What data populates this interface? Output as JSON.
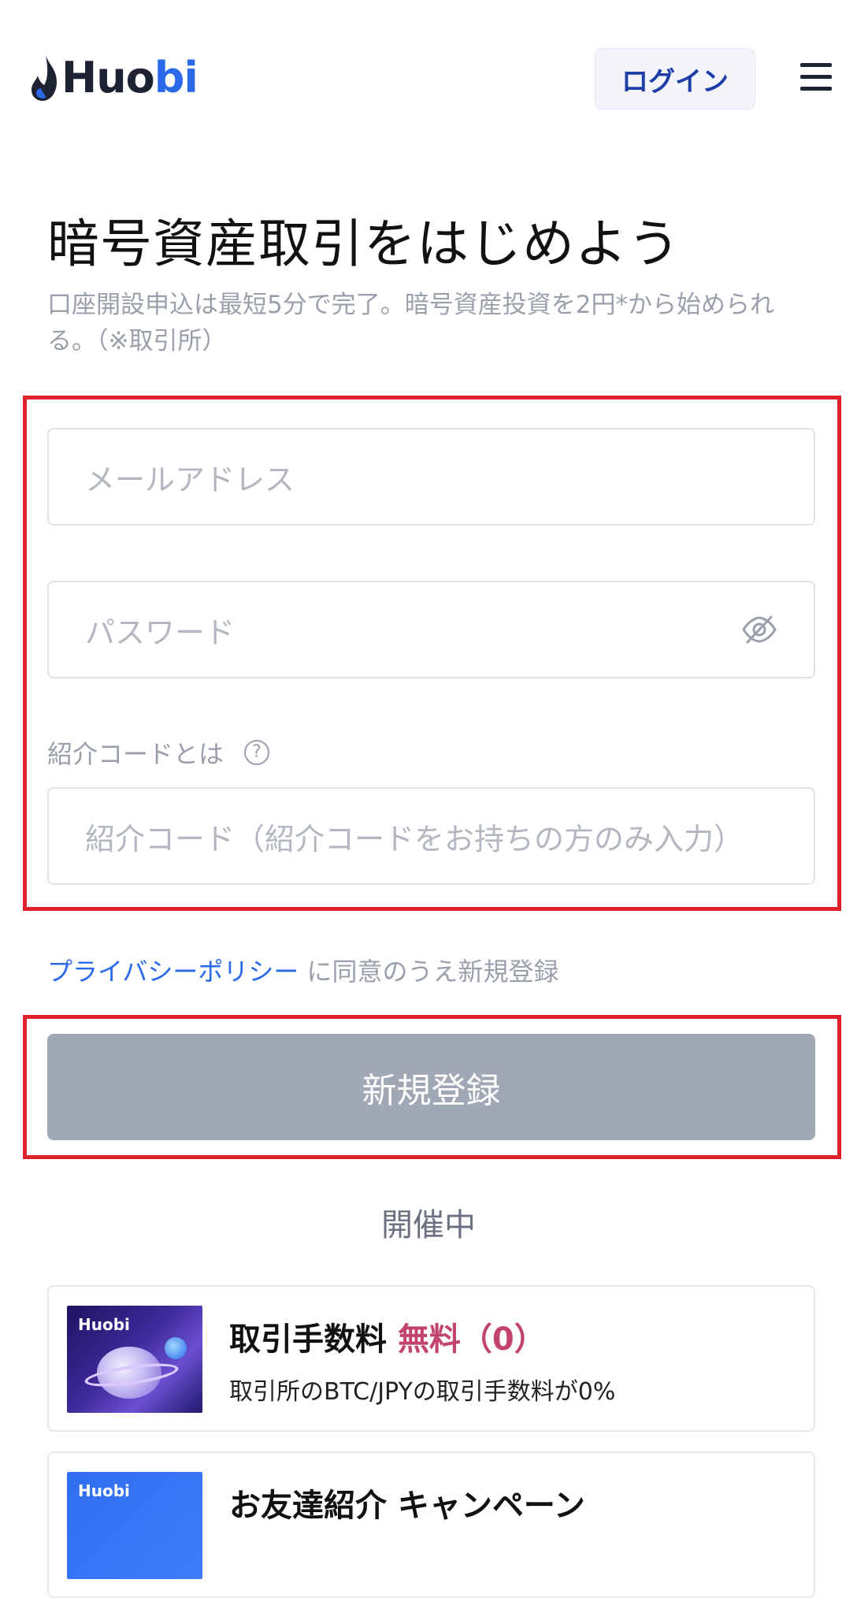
{
  "header": {
    "logo_text_part1": "Huo",
    "logo_text_part2": "bi",
    "login_label": "ログイン",
    "menu_icon": "hamburger-menu-icon"
  },
  "hero": {
    "title": "暗号資産取引をはじめよう",
    "subtitle": "口座開設申込は最短5分で完了。暗号資産投資を2円*から始められる。（※取引所）"
  },
  "form": {
    "email_placeholder": "メールアドレス",
    "password_placeholder": "パスワード",
    "password_toggle_icon": "eye-slash-icon",
    "referral_label": "紹介コードとは",
    "referral_help_icon": "question-mark-icon",
    "referral_placeholder": "紹介コード（紹介コードをお持ちの方のみ入力）"
  },
  "consent": {
    "policy_link": "プライバシーポリシー",
    "policy_text": " に同意のうえ新規登録"
  },
  "signup_button": "新規登録",
  "campaigns": {
    "section_label": "開催中",
    "items": [
      {
        "thumb_logo": "Huobi",
        "title_main": "取引手数料 ",
        "title_highlight": "無料（0）",
        "description": "取引所のBTC/JPYの取引手数料が0%"
      },
      {
        "thumb_logo": "Huobi",
        "title_main": "お友達紹介 キャンペーン",
        "title_highlight": "",
        "description": ""
      }
    ]
  },
  "colors": {
    "brand_blue": "#2a6ae8",
    "highlight_red": "#e0212b",
    "button_disabled": "#a0a8b5",
    "free_text": "#c2436f"
  }
}
